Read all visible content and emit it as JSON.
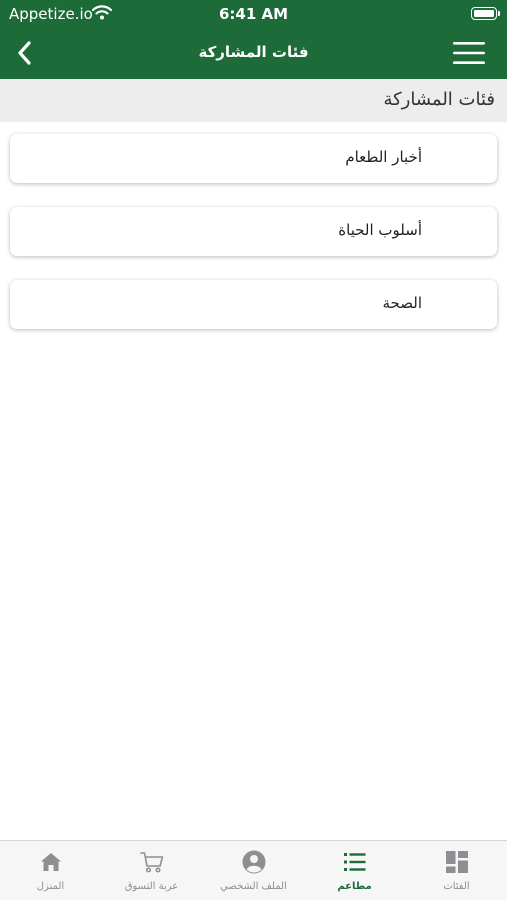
{
  "status_bar": {
    "carrier": "Appetize.io",
    "time": "6:41 AM"
  },
  "nav": {
    "title": "فئات المشاركة",
    "back_icon": "chevron-left-icon",
    "menu_icon": "hamburger-menu-icon"
  },
  "section": {
    "header": "فئات المشاركة"
  },
  "categories": [
    {
      "label": "أخبار الطعام"
    },
    {
      "label": "أسلوب الحياة"
    },
    {
      "label": "الصحة"
    }
  ],
  "tabs": [
    {
      "label": "المنزل",
      "icon": "home-icon",
      "active": false
    },
    {
      "label": "عربة التسوق",
      "icon": "cart-icon",
      "active": false
    },
    {
      "label": "الملف الشخصي",
      "icon": "profile-icon",
      "active": false
    },
    {
      "label": "مطاعم",
      "icon": "list-icon",
      "active": true
    },
    {
      "label": "الفئات",
      "icon": "categories-grid-icon",
      "active": false
    }
  ],
  "colors": {
    "brand_green": "#1e6b3a",
    "tab_inactive": "#8e8e93",
    "section_bg": "#ededee"
  }
}
